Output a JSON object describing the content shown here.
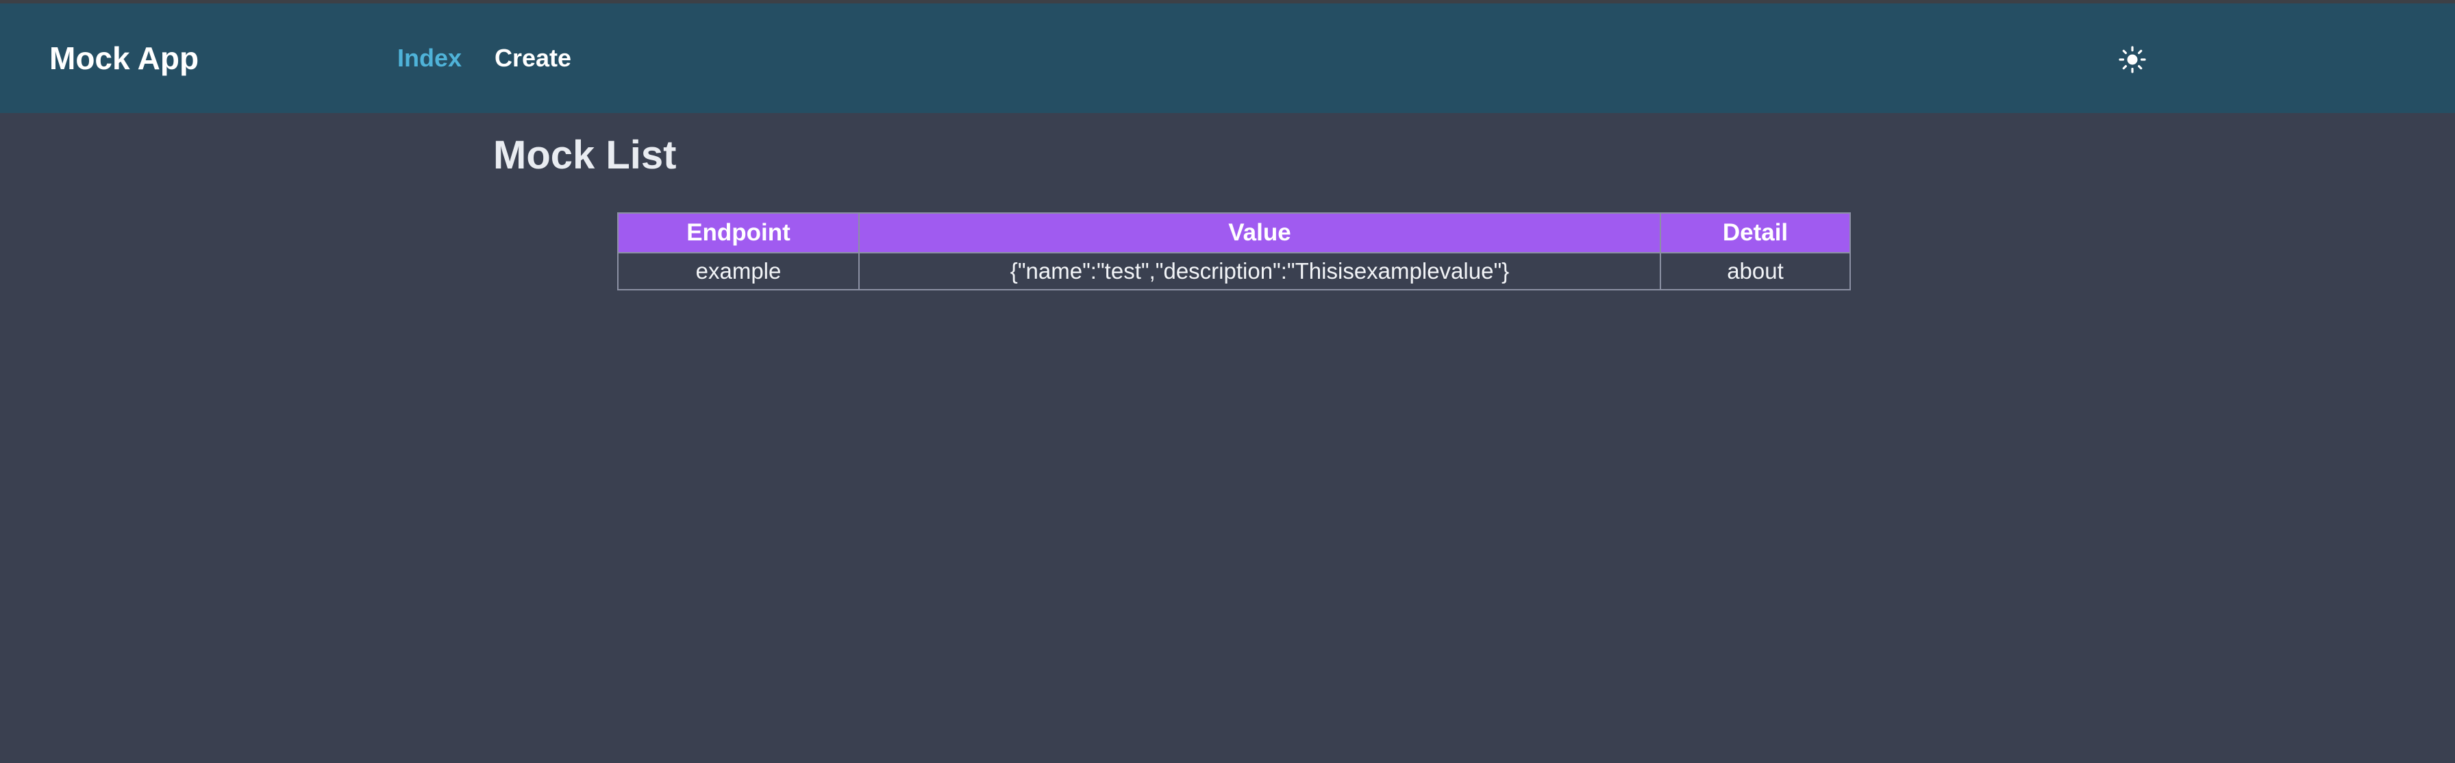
{
  "app": {
    "title": "Mock App"
  },
  "nav": {
    "items": [
      {
        "label": "Index",
        "active": true
      },
      {
        "label": "Create",
        "active": false
      }
    ],
    "active_color": "#4fb3d9",
    "theme_toggle_icon": "sun-icon"
  },
  "main": {
    "title": "Mock List",
    "table": {
      "header_color": "#a05bf0",
      "columns": [
        "Endpoint",
        "Value",
        "Detail"
      ],
      "rows": [
        {
          "endpoint": "example",
          "value": "{\"name\":\"test\",\"description\":\"Thisisexamplevalue\"}",
          "detail": "about"
        }
      ]
    }
  },
  "colors": {
    "navbar_bg": "#254e63",
    "page_bg": "#3a4050",
    "table_border": "#8b90a3"
  }
}
